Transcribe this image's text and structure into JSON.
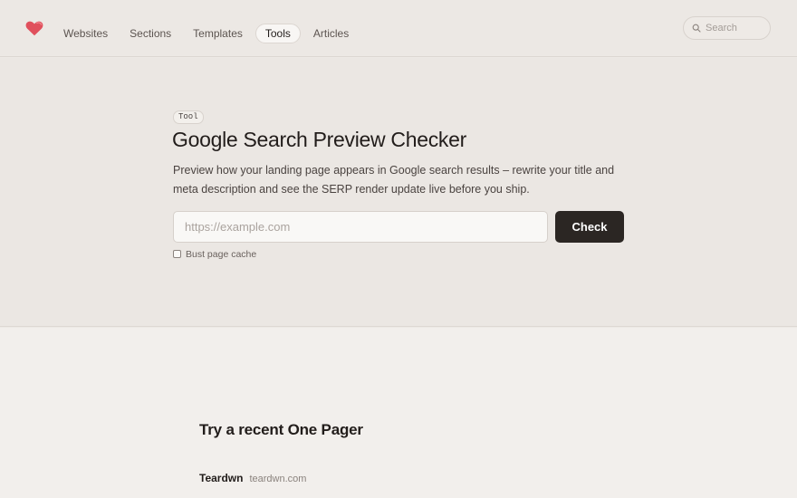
{
  "nav": {
    "items": [
      {
        "label": "Websites",
        "active": false
      },
      {
        "label": "Sections",
        "active": false
      },
      {
        "label": "Templates",
        "active": false
      },
      {
        "label": "Tools",
        "active": true
      },
      {
        "label": "Articles",
        "active": false
      }
    ]
  },
  "search": {
    "placeholder": "Search",
    "icon": "search-icon"
  },
  "logo": {
    "icon": "heart-icon",
    "color": "#e0505c"
  },
  "hero": {
    "badge": "Tool",
    "title": "Google Search Preview Checker",
    "description": "Preview how your landing page appears in Google search results – rewrite your title and meta description and see the SERP render update live before you ship.",
    "url_input": {
      "value": "",
      "placeholder": "https://example.com"
    },
    "check_label": "Check",
    "cache_label": "Bust page cache",
    "cache_checked": false
  },
  "recent": {
    "title": "Try a recent One Pager",
    "items": [
      {
        "name": "Teardwn",
        "domain": "teardwn.com"
      }
    ]
  },
  "colors": {
    "accent": "#2b2623",
    "background": "#ede9e5",
    "logo": "#e0505c"
  }
}
